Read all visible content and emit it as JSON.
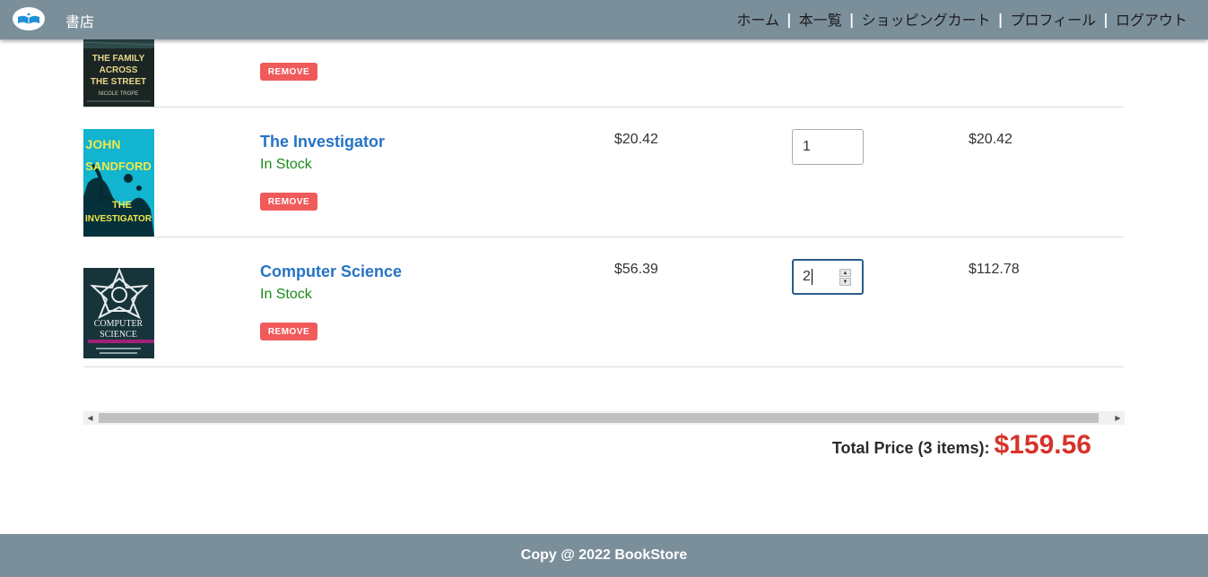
{
  "header": {
    "brand": "書店",
    "nav": [
      "ホーム",
      "本一覧",
      "ショッピングカート",
      "プロフィール",
      "ログアウト"
    ],
    "separator": "|"
  },
  "cart": {
    "items": [
      {
        "title": "",
        "stock": "",
        "remove_label": "REMOVE",
        "price": "",
        "quantity": "",
        "subtotal": "",
        "cover_text": [
          "THE FAMILY",
          "ACROSS",
          "THE STREET",
          "NICOLE TROPE"
        ]
      },
      {
        "title": "The Investigator",
        "stock": "In Stock",
        "remove_label": "REMOVE",
        "price": "$20.42",
        "quantity": "1",
        "subtotal": "$20.42",
        "cover_text": [
          "JOHN",
          "SANDFORD",
          "THE",
          "INVESTIGATOR"
        ]
      },
      {
        "title": "Computer Science",
        "stock": "In Stock",
        "remove_label": "REMOVE",
        "price": "$56.39",
        "quantity": "2",
        "subtotal": "$112.78",
        "cover_text": [
          "COMPUTER",
          "SCIENCE"
        ]
      }
    ]
  },
  "total": {
    "label": "Total Price (3 items):",
    "value": "$159.56"
  },
  "footer": {
    "text": "Copy @ 2022 BookStore"
  },
  "colors": {
    "header_bg": "#7b8f9b",
    "link": "#2574c4",
    "in_stock": "#1a8a1a",
    "remove_bg": "#f15a5a",
    "total_value": "#d6332a"
  }
}
